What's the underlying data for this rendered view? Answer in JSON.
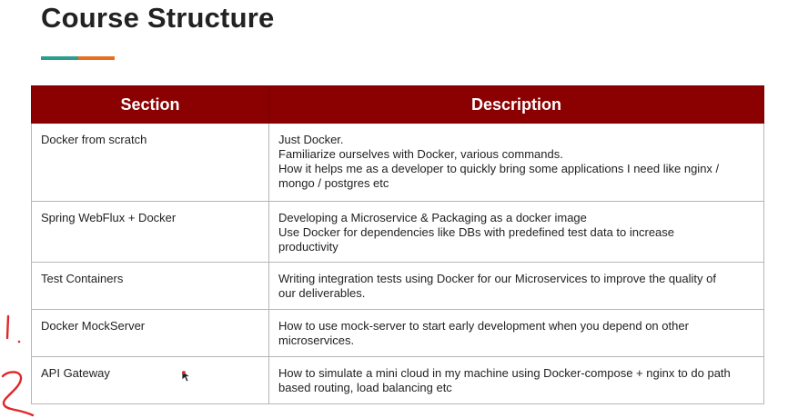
{
  "slide": {
    "title": "Course Structure"
  },
  "colors": {
    "header_bg": "#8b0000",
    "accent_left": "#2a9d8f",
    "accent_right": "#e76f1e",
    "annotation_red": "#e0262b"
  },
  "table": {
    "headers": {
      "section": "Section",
      "description": "Description"
    },
    "rows": [
      {
        "section": "Docker from scratch",
        "lines": [
          "Just Docker.",
          "Familiarize ourselves with Docker, various commands.",
          "How it helps me as a developer to quickly bring some applications I need like nginx /",
          "mongo / postgres etc"
        ]
      },
      {
        "section": "Spring WebFlux  + Docker",
        "lines": [
          "Developing a Microservice & Packaging as a docker image",
          "Use Docker for dependencies like DBs with predefined test data to increase",
          "productivity"
        ]
      },
      {
        "section": "Test Containers",
        "lines": [
          "Writing integration tests using Docker for our Microservices to improve the quality of",
          "our deliverables."
        ]
      },
      {
        "section": "Docker MockServer",
        "lines": [
          "How to use mock-server to start early development when you depend on other",
          "microservices."
        ]
      },
      {
        "section": "API Gateway",
        "lines": [
          "How to simulate a mini cloud in my machine using Docker-compose + nginx to do path",
          "based routing, load balancing etc"
        ]
      }
    ]
  },
  "annotations": {
    "mark_1": "handwritten-one",
    "mark_2": "handwritten-two",
    "cursor": "mouse-cursor-icon"
  }
}
